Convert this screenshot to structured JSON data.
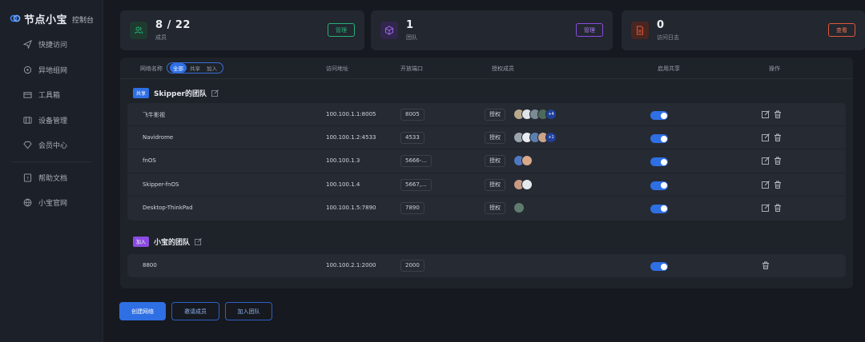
{
  "brand": {
    "name": "节点小宝",
    "subtitle": "控制台"
  },
  "sidebar": {
    "items": [
      {
        "label": "快捷访问",
        "icon": "send-icon"
      },
      {
        "label": "异地组网",
        "icon": "network-icon"
      },
      {
        "label": "工具箱",
        "icon": "toolbox-icon"
      },
      {
        "label": "设备管理",
        "icon": "device-icon"
      },
      {
        "label": "会员中心",
        "icon": "diamond-icon"
      },
      {
        "label": "帮助文档",
        "icon": "help-doc-icon"
      },
      {
        "label": "小宝官网",
        "icon": "globe-icon"
      }
    ]
  },
  "cards": [
    {
      "value": "8 / 22",
      "label": "成员",
      "button": "管理",
      "color": "#27b07a",
      "icon": "users-icon"
    },
    {
      "value": "1",
      "label": "团队",
      "button": "管理",
      "color": "#8a4ce0",
      "icon": "cube-icon"
    },
    {
      "value": "0",
      "label": "访问日志",
      "button": "查看",
      "color": "#e0583a",
      "icon": "log-file-icon"
    }
  ],
  "table": {
    "headers": {
      "name": "网络名称",
      "address": "访问地址",
      "port": "开放端口",
      "members": "授权成员",
      "share": "启用共享",
      "ops": "操作"
    },
    "filters": [
      "全部",
      "共享",
      "加入"
    ],
    "auth_label": "授权"
  },
  "groups": [
    {
      "tag": "共享",
      "name": "Skipper的团队",
      "rows": [
        {
          "name": "飞牛影视",
          "address": "100.100.1.1:8005",
          "port": "8005",
          "more": "+4",
          "avatars": 4
        },
        {
          "name": "Navidrome",
          "address": "100.100.1.2:4533",
          "port": "4533",
          "more": "+1",
          "avatars": 4
        },
        {
          "name": "fnOS",
          "address": "100.100.1.3",
          "port": "5666-...",
          "more": "",
          "avatars": 2
        },
        {
          "name": "Skipper-fnOS",
          "address": "100.100.1.4",
          "port": "5667,...",
          "more": "",
          "avatars": 2
        },
        {
          "name": "Desktop-ThinkPad",
          "address": "100.100.1.5:7890",
          "port": "7890",
          "more": "",
          "avatars": 1
        }
      ]
    },
    {
      "tag": "加入",
      "name": "小宝的团队",
      "rows": [
        {
          "name": "8800",
          "address": "100.100.2.1:2000",
          "port": "2000"
        }
      ]
    }
  ],
  "actions": {
    "create": "创建网络",
    "invite": "邀请成员",
    "join": "加入团队"
  },
  "colors": {
    "accent": "#2f6fe4",
    "share_tag": "#2f6fe4",
    "join_tag": "#8a4ce0"
  }
}
